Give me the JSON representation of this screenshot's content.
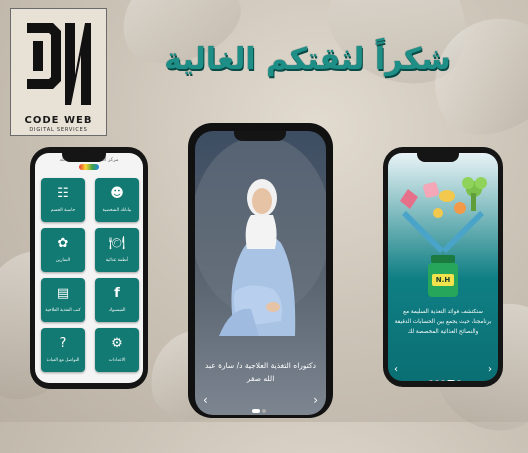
{
  "brand": {
    "name": "CODE WEB",
    "tagline": "DIGITAL SERVICES"
  },
  "headline": "شكراً لثقتكم الغالية",
  "left_phone": {
    "header": "مركز الدكتورة سارة عبد الله",
    "tiles": [
      {
        "label": "بياناتك الشخصية",
        "icon": "person-icon"
      },
      {
        "label": "حاسبة الجسم",
        "icon": "calculator-icon"
      },
      {
        "label": "أنظمة غذائية",
        "icon": "meal-icon"
      },
      {
        "label": "التمارين",
        "icon": "exercise-icon"
      },
      {
        "label": "الفيسبوك",
        "icon": "facebook-icon"
      },
      {
        "label": "كتب التغذية العلاجية",
        "icon": "book-icon"
      },
      {
        "label": "الاعدادات",
        "icon": "gear-icon"
      },
      {
        "label": "التواصل مع العيادة",
        "icon": "help-icon"
      }
    ]
  },
  "center_phone": {
    "caption": "دكتوراه التغذية العلاجية د/ سارة عبد الله صقر",
    "prev": "‹",
    "next": "›"
  },
  "right_phone": {
    "badge": "N.H",
    "description": "ستكتشف فوائد التغذية السليمة مع برنامجنا، حيث يجمع بين الحسابات الدقيقة والنصائح الغذائية المخصصة لك",
    "prev": "‹",
    "next": "›"
  },
  "colors": {
    "accent": "#127a73",
    "headline": "#1d8f87"
  }
}
